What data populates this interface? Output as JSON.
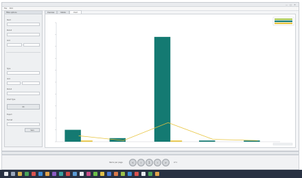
{
  "window": {
    "title": "",
    "menu": [
      "File",
      "Edit"
    ],
    "controls": [
      "—",
      "□",
      "✕"
    ]
  },
  "left_panel": {
    "header": "Filter options",
    "labels": [
      "Start",
      "Period",
      "Unit",
      "Type",
      "Unit",
      "Period",
      "Chart Type",
      "Export",
      "Format"
    ],
    "inputs": [
      "",
      "",
      "",
      "",
      "",
      "",
      "",
      "",
      ""
    ],
    "button_apply": "OK",
    "button_export": "Save"
  },
  "tabs": [
    "Overview",
    "Details",
    "Chart"
  ],
  "chart_data": {
    "type": "bar",
    "title": "",
    "xlabel": "",
    "ylabel": "",
    "categories": [
      "",
      "",
      "",
      "",
      ""
    ],
    "ylim": [
      0,
      100
    ],
    "series": [
      {
        "values": [
          10,
          3,
          88,
          1,
          1
        ],
        "color": "#147a72"
      },
      {
        "values": [
          1,
          0,
          1,
          0,
          0
        ],
        "color": "#e8c43d"
      }
    ],
    "line_series": {
      "values": [
        5,
        1,
        16,
        2,
        1
      ],
      "color": "#e8c43d"
    },
    "legend_colors": [
      "#a3c64b",
      "#147a72",
      "#e8c43d"
    ],
    "legend_placement": "top-right",
    "grid": false
  },
  "pager": {
    "left_label": "Items per page",
    "right_label": "of 1",
    "buttons": [
      "«",
      "‹",
      "1",
      "›",
      "»"
    ],
    "page_indicator": ""
  },
  "taskbar": {
    "icons": [
      "start-icon",
      "search-icon",
      "explorer-icon",
      "chrome-icon",
      "mail-icon",
      "store-icon",
      "app-icon",
      "app-icon",
      "app-icon",
      "app-icon",
      "app-icon",
      "app-icon",
      "app-icon",
      "app-icon",
      "app-icon",
      "app-icon"
    ],
    "clock": ""
  }
}
